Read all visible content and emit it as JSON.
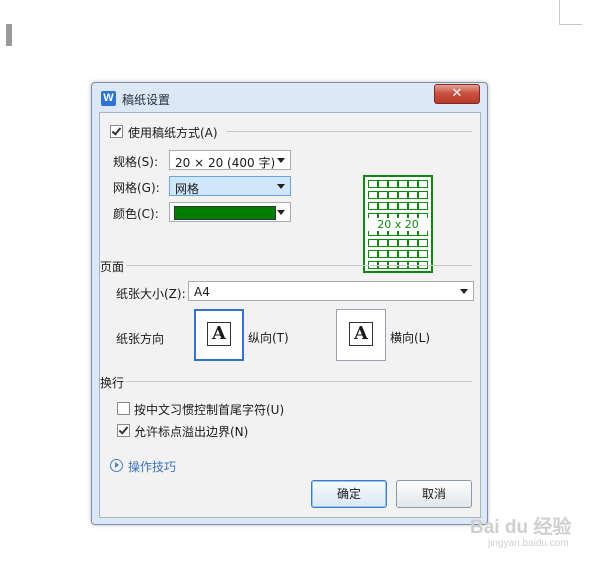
{
  "dialog": {
    "title": "稿纸设置",
    "app_icon_letter": "W",
    "close_glyph": "✕"
  },
  "manuscript": {
    "enable_label": "使用稿纸方式(A)",
    "enable_checked": true,
    "spec_label": "规格(S):",
    "spec_value": "20 × 20 (400 字)",
    "grid_label": "网格(G):",
    "grid_value": "网格",
    "color_label": "颜色(C):",
    "color_value": "#007c00",
    "preview_text": "20 x 20"
  },
  "page": {
    "section_label": "页面",
    "size_label": "纸张大小(Z):",
    "size_value": "A4",
    "orientation_label": "纸张方向",
    "portrait_label": "纵向(T)",
    "landscape_label": "横向(L)",
    "page_glyph": "A",
    "selected_orientation": "portrait"
  },
  "linebreak": {
    "section_label": "换行",
    "option1_label": "按中文习惯控制首尾字符(U)",
    "option1_checked": false,
    "option2_label": "允许标点溢出边界(N)",
    "option2_checked": true
  },
  "help": {
    "label": "操作技巧"
  },
  "buttons": {
    "ok": "确定",
    "cancel": "取消"
  },
  "watermark": {
    "main": "Bai du 经验",
    "sub": "jingyan.baidu.com"
  },
  "colors": {
    "grid_green": "#0b8a0b",
    "accent_blue": "#3473c8"
  }
}
